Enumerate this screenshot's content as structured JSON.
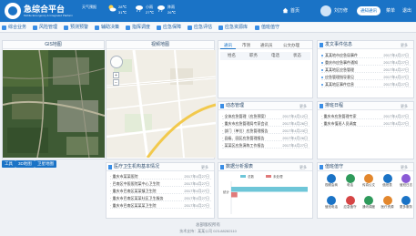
{
  "header": {
    "brand_title": "急综合平台",
    "brand_subtitle": "Mobile Emergency & Integrated Platform",
    "weather": [
      {
        "icon": "sun-cloud-icon",
        "top": "28℃",
        "bottom": "31℃"
      },
      {
        "icon": "rain-cloud-icon",
        "top": "小雨",
        "bottom": "27℃"
      },
      {
        "icon": "rain-cloud-icon",
        "top": "阵雨",
        "bottom": "26℃"
      }
    ],
    "weather_label": "天气预报",
    "home": "首页",
    "user": "刘万修",
    "msg_btn": "通知通讯",
    "settings": "菜单",
    "logout": "退出"
  },
  "toolbar": [
    {
      "label": "综合业务",
      "icon": "grid-icon"
    },
    {
      "label": "风险管理",
      "icon": "warning-icon"
    },
    {
      "label": "预测预警",
      "icon": "alert-icon"
    },
    {
      "label": "辅助决策",
      "icon": "decision-icon"
    },
    {
      "label": "指挥调度",
      "icon": "command-icon"
    },
    {
      "label": "应急保障",
      "icon": "shield-icon"
    },
    {
      "label": "应急评估",
      "icon": "chart-icon"
    },
    {
      "label": "应急资源库",
      "icon": "database-icon"
    },
    {
      "label": "值班值守",
      "icon": "duty-icon"
    }
  ],
  "gis": {
    "title": "GIS地图",
    "tabs": [
      "工具",
      "3D地图",
      "卫星地图"
    ]
  },
  "video": {
    "title": "视频地图"
  },
  "contacts": {
    "tabs": [
      "通讯",
      "市领",
      "通讯员",
      "公文办理"
    ],
    "sub": [
      "姓名",
      "职务",
      "电话",
      "状态"
    ]
  },
  "notice": {
    "title": "发文事件信息",
    "more": "更多",
    "rows": [
      {
        "t": "某某地市应急局事件",
        "d": "2017年4月27日"
      },
      {
        "t": "重庆市应急事件通知",
        "d": "2017年4月27日"
      },
      {
        "t": "某某地区应急管理",
        "d": "2017年4月27日"
      },
      {
        "t": "应急管理指导意见",
        "d": "2017年4月27日"
      },
      {
        "t": "某某地区事件信息",
        "d": "2017年4月27日"
      }
    ]
  },
  "dynamic": {
    "title": "动态管理",
    "more": "更多",
    "rows": [
      {
        "t": "· 全体应急管理（应急预案）",
        "d": "2017年4月12日"
      },
      {
        "t": "· 重庆市应急管理局专家会议",
        "d": "2017年4月26日"
      },
      {
        "t": "· 部门（单位）应急管理报告",
        "d": "2017年4月23日"
      },
      {
        "t": "· 县级、园区应急管理报告",
        "d": "2017年4月26日"
      },
      {
        "t": "· 某某区应急演练工作报告",
        "d": "2017年4月27日"
      }
    ]
  },
  "schedule": {
    "title": "排班日程",
    "more": "更多",
    "rows": [
      {
        "t": "· 重庆市应急管理专家",
        "d": "2017年4月27日"
      },
      {
        "t": "· 重庆市值班人员调度",
        "d": "2017年4月27日"
      }
    ]
  },
  "hospital": {
    "title": "医疗卫生机构基本情况",
    "more": "更多",
    "rows": [
      {
        "t": "· 重庆市某某医院",
        "d": "2017年4月27日"
      },
      {
        "t": "· 巴南区中医医院某中心卫生院",
        "d": "2017年4月27日"
      },
      {
        "t": "· 重庆市巴南区某某镇卫生院",
        "d": "2017年4月27日"
      },
      {
        "t": "· 重庆市巴南区某某社区卫生服务",
        "d": "2017年4月27日"
      },
      {
        "t": "· 重庆市巴南区某某某卫生院",
        "d": "2017年4月27日"
      }
    ]
  },
  "chart_panel": {
    "title": "数据分析报表",
    "more": "更多",
    "legend": [
      "总数",
      "未处理"
    ]
  },
  "chart_data": {
    "type": "bar",
    "categories": [
      "统计"
    ],
    "series": [
      {
        "name": "总数",
        "values": [
          100
        ]
      },
      {
        "name": "未处理",
        "values": [
          8
        ]
      }
    ],
    "xlim": [
      0,
      100
    ]
  },
  "duty": {
    "title": "值班值守",
    "more": "更多",
    "items": [
      {
        "label": "视频会商",
        "icon": "video-icon"
      },
      {
        "label": "电话",
        "icon": "phone-icon"
      },
      {
        "label": "传真公文",
        "icon": "fax-icon"
      },
      {
        "label": "值班表",
        "icon": "calendar-icon"
      },
      {
        "label": "值班日志",
        "icon": "log-icon"
      },
      {
        "label": "值班电话",
        "icon": "phone-book-icon"
      },
      {
        "label": "应急值守",
        "icon": "guard-icon"
      },
      {
        "label": "通讯调度",
        "icon": "dispatch-icon"
      },
      {
        "label": "医疗资源",
        "icon": "medical-icon"
      },
      {
        "label": "更多服务",
        "icon": "more-icon"
      }
    ]
  },
  "footer": {
    "line1": "总部版权所有",
    "line2": "技术支持：某某公司 023-88282110"
  }
}
